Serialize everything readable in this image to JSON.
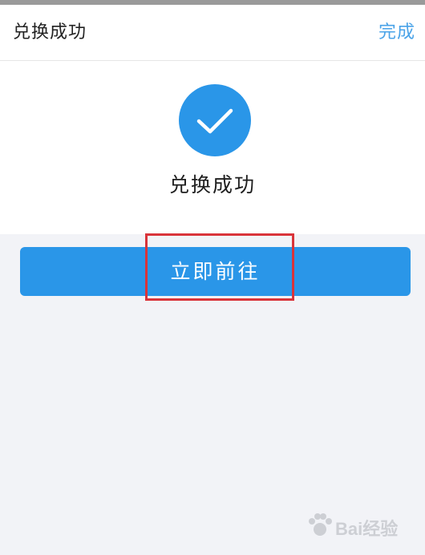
{
  "nav": {
    "title": "兑换成功",
    "done_label": "完成"
  },
  "result": {
    "icon": "checkmark-circle-icon",
    "message": "兑换成功"
  },
  "action": {
    "go_label": "立即前往"
  },
  "annotation": {
    "highlight_color": "#d9343a"
  },
  "watermark": {
    "text": "Bai经验"
  },
  "colors": {
    "accent": "#2a96e8",
    "link": "#4aa3e8",
    "page_background": "#f2f3f7"
  }
}
